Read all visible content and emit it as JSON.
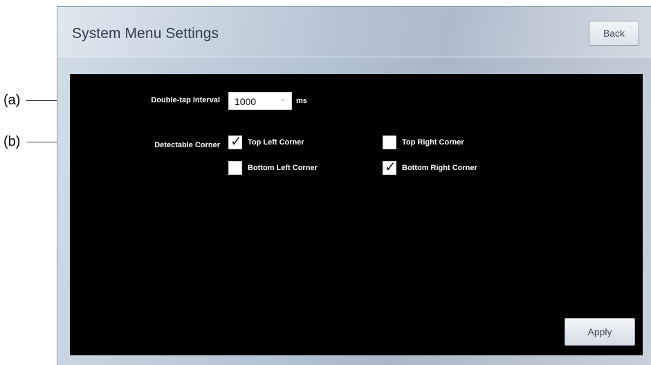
{
  "callouts": {
    "a": "(a)",
    "b": "(b)"
  },
  "window": {
    "title": "System Menu Settings",
    "back_label": "Back"
  },
  "settings": {
    "double_tap": {
      "label": "Double-tap Interval",
      "value": "1000",
      "unit": "ms"
    },
    "detectable_corner": {
      "label": "Detectable Corner",
      "corners": [
        {
          "label": "Top Left Corner",
          "checked": true
        },
        {
          "label": "Top Right Corner",
          "checked": false
        },
        {
          "label": "Bottom Left Corner",
          "checked": false
        },
        {
          "label": "Bottom Right Corner",
          "checked": true
        }
      ]
    }
  },
  "actions": {
    "apply_label": "Apply"
  },
  "icons": {
    "checkmark_glyph": "✓",
    "chevron_glyph": "⌄"
  }
}
